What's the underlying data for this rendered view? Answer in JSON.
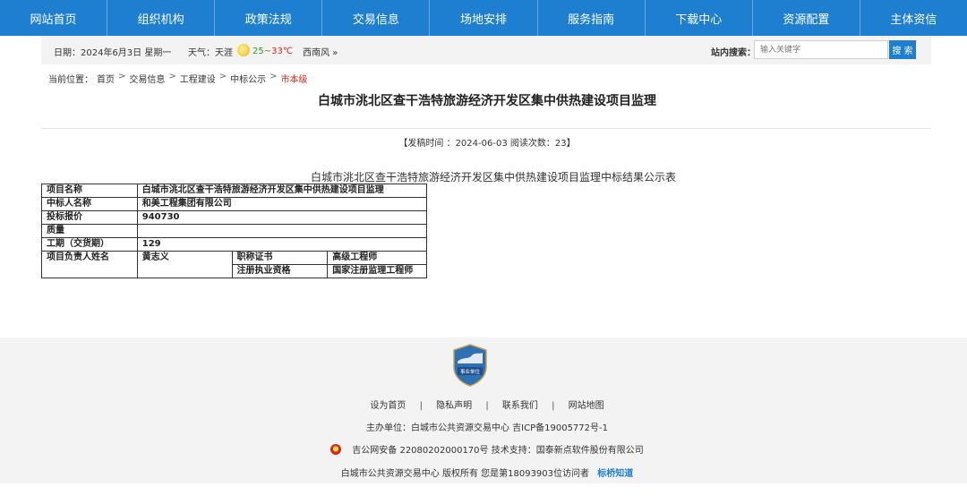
{
  "nav": {
    "items": [
      "网站首页",
      "组织机构",
      "政策法规",
      "交易信息",
      "场地安排",
      "服务指南",
      "下载中心",
      "资源配置",
      "主体资信"
    ]
  },
  "infobar": {
    "date": "日期：2024年6月3日  星期一",
    "weather_label": "天气：天涯",
    "temp_low": "25",
    "temp_sep": "~",
    "temp_high": "33℃",
    "wind": "西南风 »",
    "search_label": "站内搜索：",
    "search_placeholder": "输入关键字",
    "search_button": "搜 索"
  },
  "breadcrumb": {
    "prefix": "当前位置：",
    "items": [
      "首页",
      "交易信息",
      "工程建设",
      "中标公示"
    ],
    "separator": ">",
    "current": "市本级"
  },
  "article": {
    "title": "白城市洮北区查干浩特旅游经济开发区集中供热建设项目监理",
    "meta": "【发稿时间 ：2024-06-03   阅读次数：23】",
    "table_caption": "白城市洮北区查干浩特旅游经济开发区集中供热建设项目监理中标结果公示表",
    "table": {
      "project_name_label": "项目名称",
      "project_name_value": "白城市洮北区查干浩特旅游经济开发区集中供热建设项目监理",
      "winner_label": "中标人名称",
      "winner_value": "和美工程集团有限公司",
      "price_label": "投标报价",
      "price_value": "940730",
      "quality_label": "质量",
      "quality_value": "",
      "period_label": "工期（交货期）",
      "period_value": "129",
      "manager_label": "项目负责人姓名",
      "manager_value": "黄志义",
      "cert_label": "职称证书",
      "cert_value": "高级工程师",
      "reg_label": "注册执业资格",
      "reg_value": "国家注册监理工程师"
    }
  },
  "footer": {
    "badge_text": "事业单位",
    "links": [
      "设为首页",
      "隐私声明",
      "联系我们",
      "网站地图"
    ],
    "link_separator": "|",
    "host": "主办单位：白城市公共资源交易中心  吉ICP备19005772号-1",
    "police": "吉公网安备 22080202000170号  技术支持：国泰新点软件股份有限公司",
    "copyright": "白城市公共资源交易中心 版权所有  您是第18093903位访问者",
    "copyright_link": "标桥知道"
  },
  "colors": {
    "nav_bg": "#1e7fd0",
    "breadcrumb_current": "#d9261c",
    "footer_bg": "#f3f3f3"
  }
}
